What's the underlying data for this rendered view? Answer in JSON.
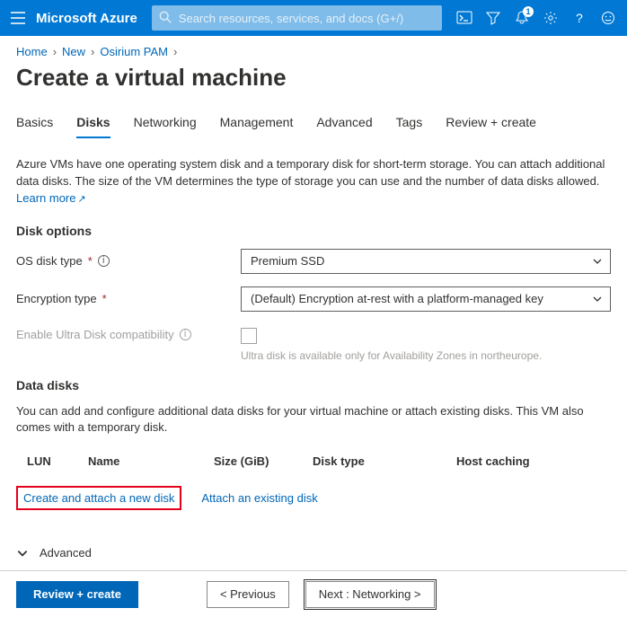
{
  "header": {
    "brand": "Microsoft Azure",
    "search_placeholder": "Search resources, services, and docs (G+/)",
    "notification_count": "1"
  },
  "breadcrumbs": [
    {
      "label": "Home"
    },
    {
      "label": "New"
    },
    {
      "label": "Osirium PAM"
    }
  ],
  "page_title": "Create a virtual machine",
  "tabs": [
    {
      "label": "Basics"
    },
    {
      "label": "Disks",
      "active": true
    },
    {
      "label": "Networking"
    },
    {
      "label": "Management"
    },
    {
      "label": "Advanced"
    },
    {
      "label": "Tags"
    },
    {
      "label": "Review + create"
    }
  ],
  "intro_text": "Azure VMs have one operating system disk and a temporary disk for short-term storage. You can attach additional data disks. The size of the VM determines the type of storage you can use and the number of data disks allowed.",
  "learn_more": "Learn more",
  "disk_options": {
    "heading": "Disk options",
    "os_disk_label": "OS disk type",
    "os_disk_value": "Premium SSD",
    "encryption_label": "Encryption type",
    "encryption_value": "(Default) Encryption at-rest with a platform-managed key",
    "ultra_label": "Enable Ultra Disk compatibility",
    "ultra_hint": "Ultra disk is available only for Availability Zones in northeurope."
  },
  "data_disks": {
    "heading": "Data disks",
    "desc": "You can add and configure additional data disks for your virtual machine or attach existing disks. This VM also comes with a temporary disk.",
    "columns": {
      "lun": "LUN",
      "name": "Name",
      "size": "Size (GiB)",
      "type": "Disk type",
      "cache": "Host caching"
    },
    "create_link": "Create and attach a new disk",
    "attach_link": "Attach an existing disk"
  },
  "advanced_label": "Advanced",
  "footer": {
    "review": "Review + create",
    "previous": "< Previous",
    "next": "Next : Networking >"
  }
}
